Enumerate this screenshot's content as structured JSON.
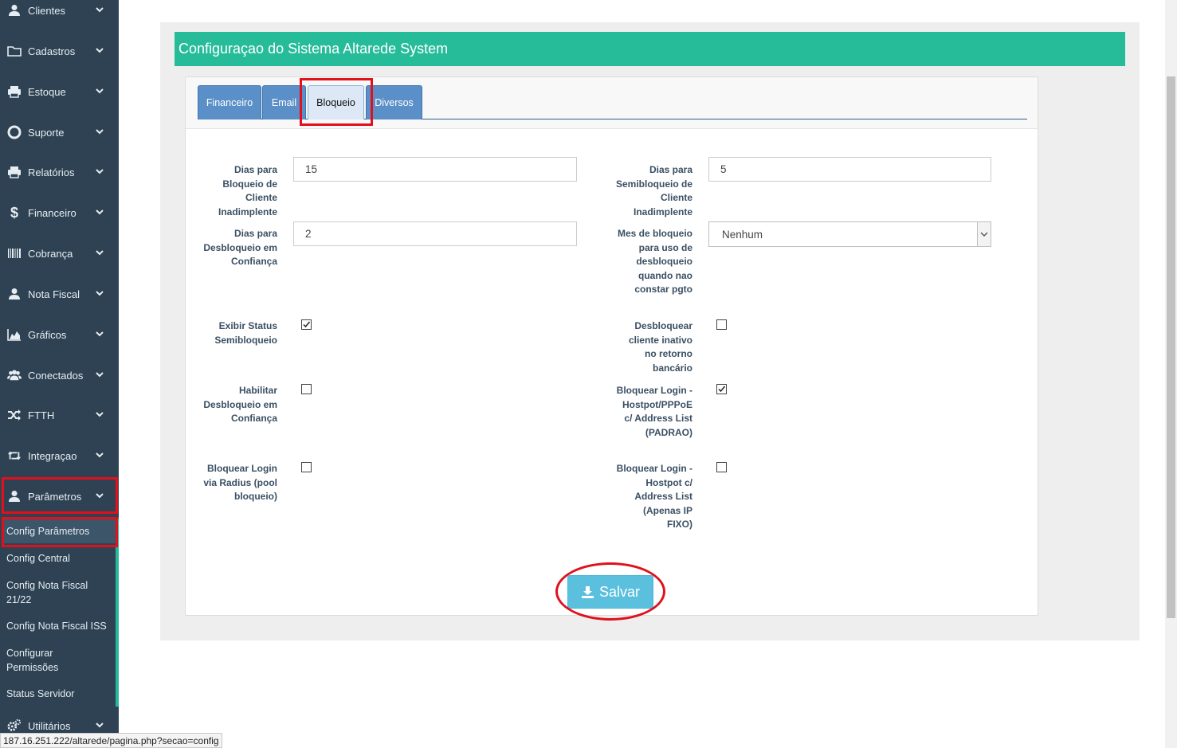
{
  "sidebar": {
    "items": [
      {
        "label": "Clientes",
        "icon": "user-icon"
      },
      {
        "label": "Cadastros",
        "icon": "folder-icon"
      },
      {
        "label": "Estoque",
        "icon": "print-icon"
      },
      {
        "label": "Suporte",
        "icon": "lifebuoy-icon"
      },
      {
        "label": "Relatórios",
        "icon": "print-icon"
      },
      {
        "label": "Financeiro",
        "icon": "dollar-icon"
      },
      {
        "label": "Cobrança",
        "icon": "barcode-icon"
      },
      {
        "label": "Nota Fiscal",
        "icon": "user-icon"
      },
      {
        "label": "Gráficos",
        "icon": "area-chart-icon"
      },
      {
        "label": "Conectados",
        "icon": "users-icon"
      },
      {
        "label": "FTTH",
        "icon": "random-icon"
      },
      {
        "label": "Integraçao",
        "icon": "retweet-icon"
      },
      {
        "label": "Parâmetros",
        "icon": "user-icon"
      },
      {
        "label": "Utilitários",
        "icon": "gears-icon"
      }
    ],
    "sub_items": [
      {
        "label": "Config Parâmetros"
      },
      {
        "label": "Config Central"
      },
      {
        "label": "Config Nota Fiscal 21/22"
      },
      {
        "label": "Config Nota Fiscal ISS"
      },
      {
        "label": "Configurar Permissões"
      },
      {
        "label": "Status Servidor"
      }
    ]
  },
  "panel": {
    "title": "Configuraçao do Sistema Altarede System"
  },
  "tabs": [
    {
      "label": "Financeiro"
    },
    {
      "label": "Email"
    },
    {
      "label": "Bloqueio"
    },
    {
      "label": "Diversos"
    }
  ],
  "form": {
    "dias_bloqueio": {
      "label": "Dias para Bloqueio de Cliente Inadimplente",
      "value": "15"
    },
    "dias_semibloqueio": {
      "label": "Dias para Semibloqueio de Cliente Inadimplente",
      "value": "5"
    },
    "dias_desbloqueio": {
      "label": "Dias para Desbloqueio em Confiança",
      "value": "2"
    },
    "mes_bloqueio": {
      "label": "Mes de bloqueio para uso de desbloqueio quando nao constar pgto",
      "value": "Nenhum"
    },
    "exibir_status": {
      "label": "Exibir Status Semibloqueio",
      "checked": true
    },
    "desbloquear_inativo": {
      "label": "Desbloquear cliente inativo no retorno bancário",
      "checked": false
    },
    "habilitar_desbloqueio": {
      "label": "Habilitar Desbloqueio em Confiança",
      "checked": false
    },
    "bloquear_hostpot_pppoe": {
      "label": "Bloquear Login - Hostpot/PPPoE c/ Address List (PADRAO)",
      "checked": true
    },
    "bloquear_radius": {
      "label": "Bloquear Login via Radius (pool bloqueio)",
      "checked": false
    },
    "bloquear_hostpot_ip": {
      "label": "Bloquear Login - Hostpot c/ Address List (Apenas IP FIXO)",
      "checked": false
    }
  },
  "save_button": {
    "label": "Salvar",
    "icon": "download-icon"
  },
  "status_url": "187.16.251.222/altarede/pagina.php?secao=config",
  "colors": {
    "sidebar_bg": "#2e4253",
    "header_green": "#26bc9a",
    "tab_blue": "#5b8fc7",
    "save_blue": "#5bc0de",
    "highlight_red": "#e0101c"
  }
}
